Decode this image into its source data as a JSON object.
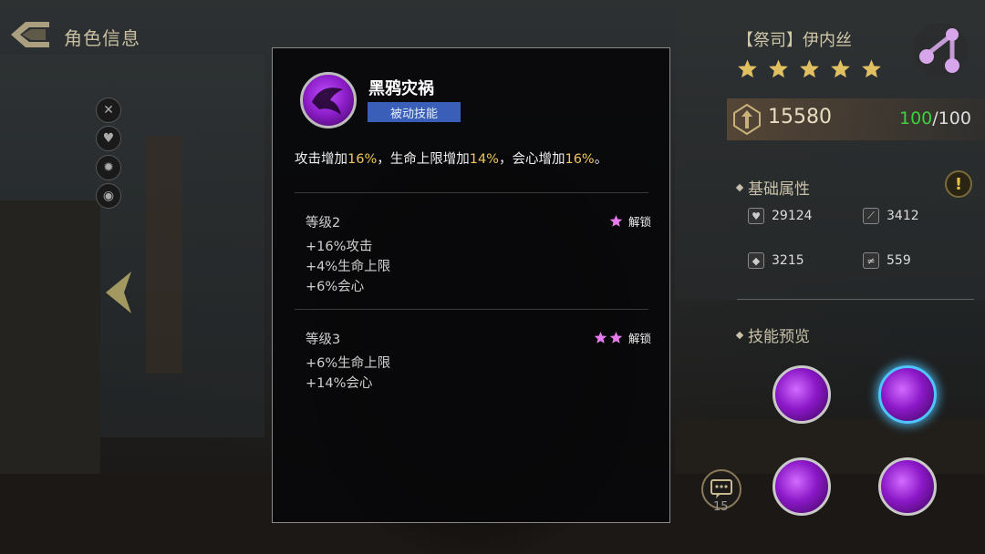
{
  "header": {
    "title": "角色信息"
  },
  "modal": {
    "skill_name": "黑鸦灾祸",
    "skill_type": "被动技能",
    "description": {
      "p1": "攻击增加",
      "v1": "16%",
      "p2": "，生命上限增加",
      "v2": "14%",
      "p3": "，会心增加",
      "v3": "16%",
      "p4": "。"
    },
    "levels": [
      {
        "title": "等级2",
        "unlock_label": "解锁",
        "stars_required": 1,
        "lines": [
          "+16%攻击",
          "+4%生命上限",
          "+6%会心"
        ]
      },
      {
        "title": "等级3",
        "unlock_label": "解锁",
        "stars_required": 2,
        "lines": [
          "+6%生命上限",
          "+14%会心"
        ]
      }
    ]
  },
  "character": {
    "name": "【祭司】伊内丝",
    "stars": 5,
    "power": "15580",
    "stamina_current": "100",
    "stamina_max": "/100"
  },
  "sections": {
    "basic_attributes": "基础属性",
    "skill_preview": "技能预览"
  },
  "stats": [
    {
      "icon": "heart-icon",
      "value": "29124"
    },
    {
      "icon": "sword-icon",
      "value": "3412"
    },
    {
      "icon": "shield-icon",
      "value": "3215"
    },
    {
      "icon": "speed-icon",
      "value": "559"
    }
  ],
  "chat": {
    "count": "15"
  },
  "colors": {
    "highlight": "#f0c65a",
    "skill_tag": "#3a5fb8",
    "star_pink": "#e87af0",
    "star_gold": "#e0c060",
    "stamina_green": "#3fcf3f",
    "selected_glow": "#4ec5ff"
  }
}
